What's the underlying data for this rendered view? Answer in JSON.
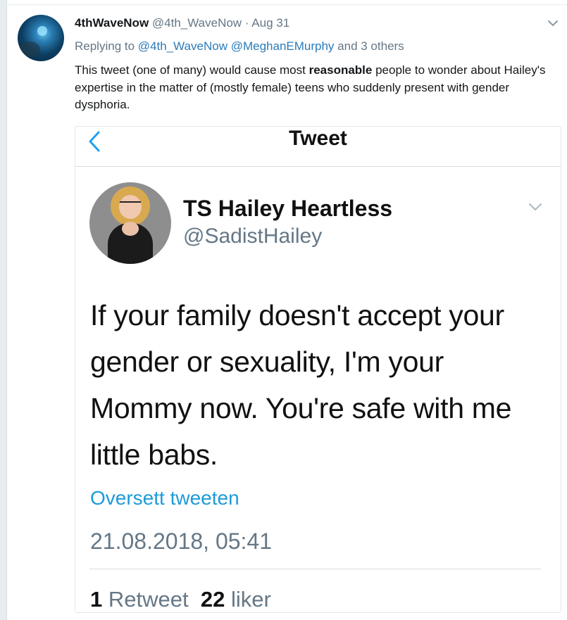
{
  "tweet": {
    "author_name": "4thWaveNow",
    "author_handle": "@4th_WaveNow",
    "separator": "·",
    "date": "Aug 31",
    "reply_prefix": "Replying to",
    "reply_to_1": "@4th_WaveNow",
    "reply_to_2": "@MeghanEMurphy",
    "reply_suffix": "and 3 others",
    "body_before": "This tweet (one of many) would cause most ",
    "body_bold": "reasonable",
    "body_after": " people to wonder about Hailey's expertise in the matter of (mostly female) teens who suddenly present with gender dysphoria.",
    "caret_icon": "chevron-down-icon"
  },
  "embedded": {
    "nav_title": "Tweet",
    "back_icon": "chevron-left-icon",
    "name": "TS Hailey Heartless",
    "handle": "@SadistHailey",
    "text": "If your family doesn't accept your gender or sexuality, I'm your Mommy now. You're safe with me little babs.",
    "translate_label": "Oversett tweeten",
    "timestamp": "21.08.2018, 05:41",
    "retweet_count": "1",
    "retweet_label": "Retweet",
    "like_count": "22",
    "like_label": "liker"
  },
  "colors": {
    "link": "#2b7bb9",
    "muted": "#657786",
    "translate": "#1d9bd7",
    "back_chevron": "#1da1f2"
  }
}
